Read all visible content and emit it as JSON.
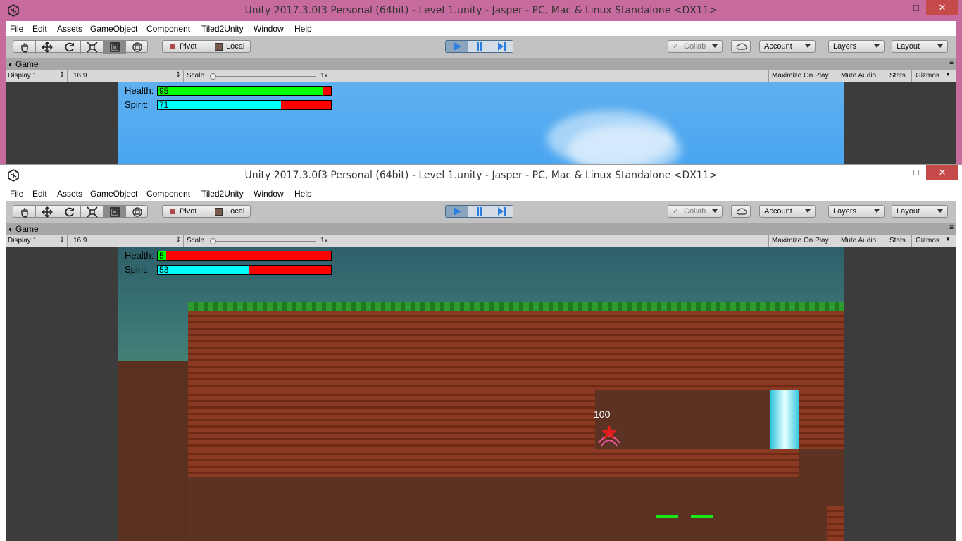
{
  "window_back": {
    "title": "Unity 2017.3.0f3 Personal (64bit) - Level 1.unity - Jasper - PC, Mac & Linux Standalone <DX11>",
    "hud": {
      "health_label": "Health:",
      "health_value": "95",
      "health_fraction": 0.95,
      "spirit_label": "Spirit:",
      "spirit_value": "71",
      "spirit_fraction": 0.71
    }
  },
  "window_front": {
    "title": "Unity 2017.3.0f3 Personal (64bit) - Level 1.unity - Jasper - PC, Mac & Linux Standalone <DX11>",
    "hud": {
      "health_label": "Health:",
      "health_value": "5",
      "health_fraction": 0.05,
      "spirit_label": "Spirit:",
      "spirit_value": "53",
      "spirit_fraction": 0.53
    },
    "enemy_value": "100"
  },
  "menu": [
    "File",
    "Edit",
    "Assets",
    "GameObject",
    "Component",
    "Tiled2Unity",
    "Window",
    "Help"
  ],
  "toolbar": {
    "pivot": "Pivot",
    "local": "Local",
    "collab": "Collab",
    "account": "Account",
    "layers": "Layers",
    "layout": "Layout",
    "tools": [
      "hand-tool",
      "move-tool",
      "rotate-tool",
      "scale-tool",
      "rect-tool",
      "transform-tool"
    ]
  },
  "game_tab": {
    "label": "Game"
  },
  "game_controls": {
    "display": "Display 1",
    "aspect": "16:9",
    "scale_label": "Scale",
    "scale_value": "1x",
    "maximize": "Maximize On Play",
    "mute": "Mute Audio",
    "stats": "Stats",
    "gizmos": "Gizmos"
  },
  "colors": {
    "health": "#00ff00",
    "spirit": "#00ffff",
    "empty": "#ff0000",
    "play_active": "#2a7de1"
  }
}
